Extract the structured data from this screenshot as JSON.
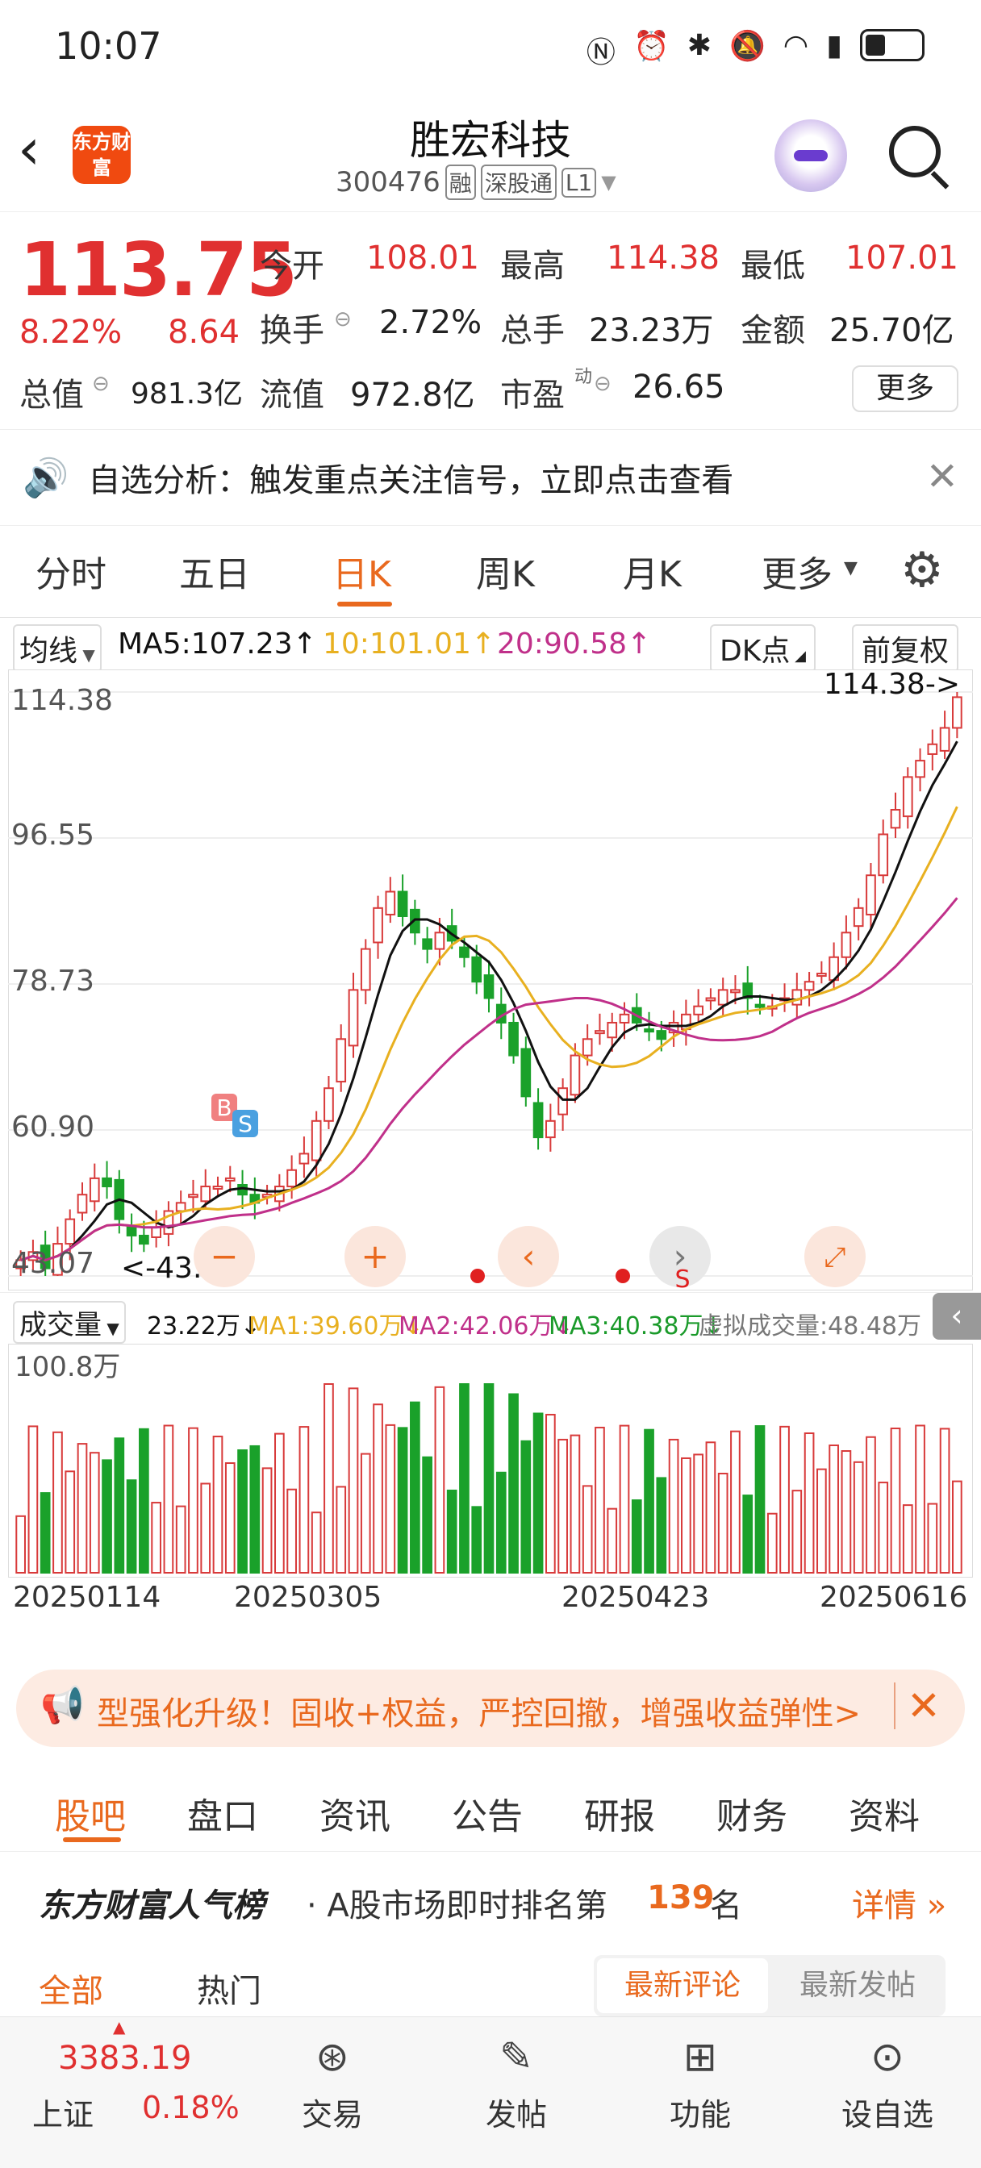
{
  "status_bar": {
    "time": "10:07"
  },
  "header": {
    "back_icon": "chevron-left-icon",
    "logo_text": "东方财富",
    "title": "胜宏科技",
    "code": "300476",
    "tags": [
      "融",
      "深股通",
      "L1"
    ],
    "search_icon": "search-icon"
  },
  "quote": {
    "price": "113.75",
    "change_pct": "8.22%",
    "change": "8.64",
    "open_label": "今开",
    "open": "108.01",
    "high_label": "最高",
    "high": "114.38",
    "low_label": "最低",
    "low": "107.01",
    "turnover_label": "换手",
    "turnover": "2.72%",
    "volume_label": "总手",
    "volume": "23.23万",
    "amount_label": "金额",
    "amount": "25.70亿",
    "mktcap_label": "总值",
    "mktcap": "981.3亿",
    "float_label": "流值",
    "float": "972.8亿",
    "pe_label": "市盈",
    "pe_sup": "动",
    "pe": "26.65",
    "more_button": "更多"
  },
  "notice": {
    "text": "自选分析：触发重点关注信号，立即点击查看"
  },
  "kline_tabs": [
    "分时",
    "五日",
    "日K",
    "周K",
    "月K",
    "更多"
  ],
  "kline_active": 2,
  "ma_line": {
    "selector": "均线",
    "ma5": "MA5:107.23↑",
    "ma10": "10:101.01↑",
    "ma20": "20:90.58↑",
    "dk": "DK点",
    "adjust": "前复权"
  },
  "chart_data": {
    "type": "candlestick",
    "y_ticks": [
      "114.38",
      "96.55",
      "78.73",
      "60.90",
      "43.07"
    ],
    "max_label": "114.38->",
    "min_label": "<-43.07",
    "buy_marker": "B",
    "sell_marker": "S",
    "sell_marker_2": "S",
    "closes": [
      45,
      46,
      44,
      47,
      50,
      53,
      55,
      54,
      50,
      48,
      47,
      49,
      51,
      52,
      53,
      54,
      54,
      55,
      53,
      52,
      53,
      54,
      56,
      58,
      62,
      66,
      72,
      78,
      83,
      88,
      90,
      87,
      85,
      83,
      85,
      84,
      82,
      79,
      77,
      74,
      70,
      65,
      60,
      62,
      66,
      70,
      72,
      73,
      74,
      75,
      74,
      73,
      72,
      74,
      75,
      76,
      77,
      78,
      78,
      77,
      76,
      76,
      77,
      78,
      79,
      80,
      82,
      85,
      88,
      92,
      97,
      100,
      104,
      106,
      108,
      110,
      113.75
    ],
    "series": [
      {
        "values": "MA5"
      },
      {
        "values": "MA10"
      },
      {
        "values": "MA20"
      }
    ],
    "colors": {
      "up": "#d83a3a",
      "down": "#1aa12a",
      "ma5": "#111111",
      "ma10": "#e8b020",
      "ma20": "#c0308a"
    }
  },
  "volume": {
    "selector": "成交量",
    "vol": "23.22万↓",
    "ma1": "MA1:39.60万↓",
    "ma2": "MA2:42.06万↓",
    "ma3": "MA3:40.38万↓",
    "virtual": "虚拟成交量:48.48万",
    "max_label": "100.8万",
    "dates": [
      "20250114",
      "20250305",
      "20250423",
      "20250616"
    ]
  },
  "banner": {
    "text": "型强化升级！固收+权益，严控回撤，增强收益弹性>"
  },
  "bottom_tabs": [
    "股吧",
    "盘口",
    "资讯",
    "公告",
    "研报",
    "财务",
    "资料"
  ],
  "rank": {
    "brand": "东方财富人气榜",
    "text_pre": "· A股市场即时排名第",
    "rank": "139",
    "text_post": "名",
    "detail": "详情"
  },
  "filter_tabs": [
    "全部",
    "热门"
  ],
  "sort_tabs": [
    "最新评论",
    "最新发帖"
  ],
  "bottom_nav": {
    "index_value": "3383.19",
    "index_name": "上证",
    "index_change": "0.18%",
    "items": [
      "交易",
      "发帖",
      "功能",
      "设自选"
    ]
  }
}
